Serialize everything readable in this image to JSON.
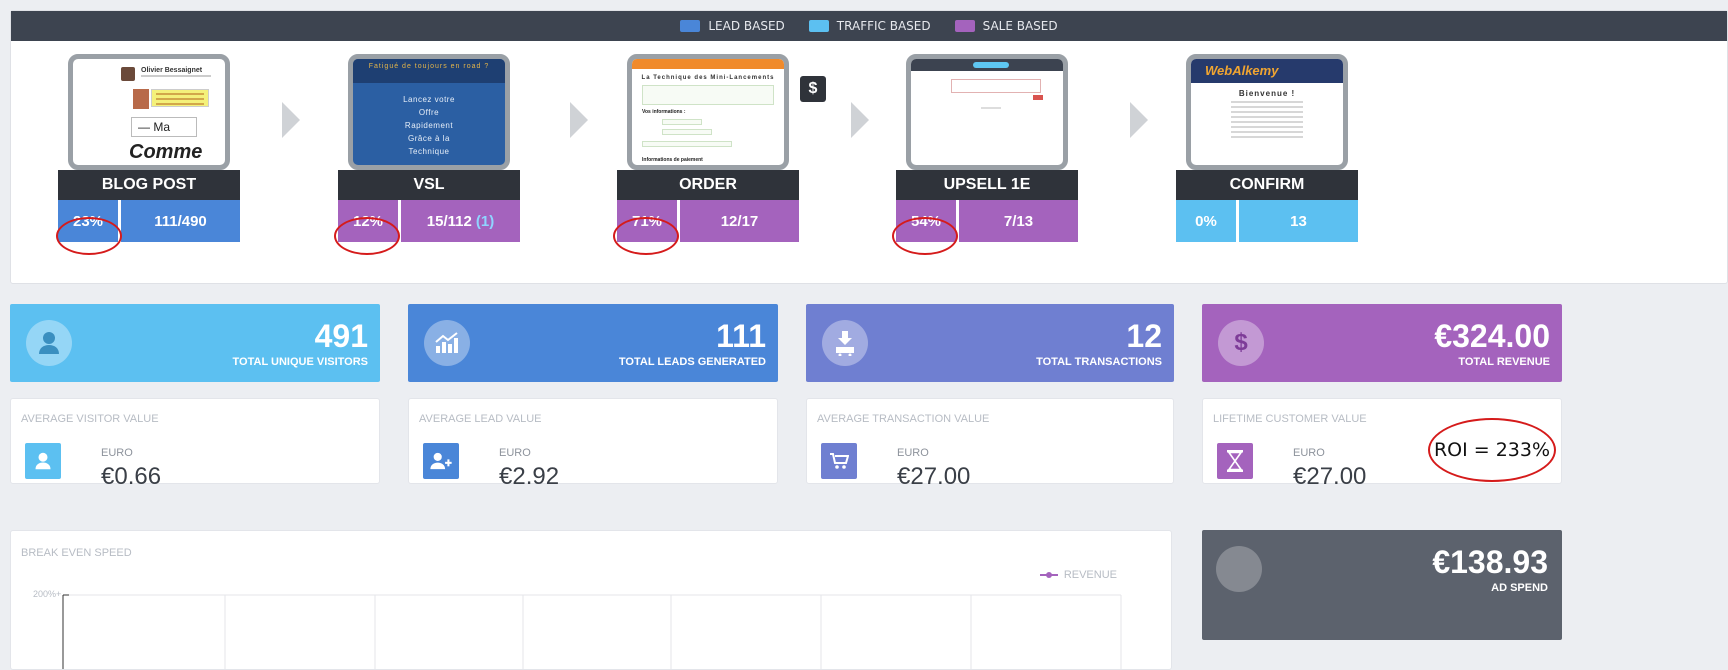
{
  "legend": [
    {
      "label": "LEAD BASED",
      "color": "#4a86d8"
    },
    {
      "label": "TRAFFIC BASED",
      "color": "#5cc0f1"
    },
    {
      "label": "SALE BASED",
      "color": "#a463bd"
    }
  ],
  "colors": {
    "lead": "#4a86d8",
    "traffic": "#5cc0f1",
    "sale": "#a463bd",
    "dark": "#2f333a",
    "annotation": "#d51b1b"
  },
  "funnel": {
    "steps": [
      {
        "title": "BLOG POST",
        "pct": "23%",
        "count": "111/490",
        "paren": "",
        "type": "lead"
      },
      {
        "title": "VSL",
        "pct": "12%",
        "count": "15/112",
        "paren": "(1)",
        "type": "sale"
      },
      {
        "title": "ORDER",
        "pct": "71%",
        "count": "12/17",
        "paren": "",
        "type": "sale"
      },
      {
        "title": "UPSELL 1E",
        "pct": "54%",
        "count": "7/13",
        "paren": "",
        "type": "sale"
      },
      {
        "title": "CONFIRM",
        "pct": "0%",
        "count": "13",
        "paren": "",
        "type": "traffic"
      }
    ],
    "order_badge": "$",
    "thumbs": {
      "blog_name": "Olivier Bessaignet",
      "blog_input": "— Ma",
      "blog_comment": "Comme",
      "vsl_top": "Fatigué de toujours en road ?",
      "vsl_body": [
        "Lancez votre",
        "Offre",
        "Rapidement",
        "Grâce à la",
        "Technique"
      ],
      "order_title": "La Technique des Mini-Lancements",
      "order_label1": "Vos informations :",
      "order_label2": "Informations de paiement",
      "confirm_logo": "WebAlkemy",
      "confirm_heading": "Bienvenue !"
    }
  },
  "stats": [
    {
      "value": "491",
      "label": "TOTAL UNIQUE VISITORS",
      "color": "#5cc0f1",
      "icon": "user-icon"
    },
    {
      "value": "111",
      "label": "TOTAL LEADS GENERATED",
      "color": "#4a86d8",
      "icon": "chart-up-icon"
    },
    {
      "value": "12",
      "label": "TOTAL TRANSACTIONS",
      "color": "#6f7fd1",
      "icon": "cart-download-icon"
    },
    {
      "value": "€324.00",
      "label": "TOTAL REVENUE",
      "color": "#a463bd",
      "icon": "dollar-icon"
    }
  ],
  "values": [
    {
      "title": "AVERAGE VISITOR VALUE",
      "unit": "EURO",
      "value": "€0.66",
      "color": "#5cc0f1",
      "icon": "user-icon"
    },
    {
      "title": "AVERAGE LEAD VALUE",
      "unit": "EURO",
      "value": "€2.92",
      "color": "#4a86d8",
      "icon": "user-add-icon"
    },
    {
      "title": "AVERAGE TRANSACTION VALUE",
      "unit": "EURO",
      "value": "€27.00",
      "color": "#6f7fd1",
      "icon": "cart-icon"
    },
    {
      "title": "LIFETIME CUSTOMER VALUE",
      "unit": "EURO",
      "value": "€27.00",
      "color": "#a463bd",
      "icon": "hourglass-icon"
    }
  ],
  "roi": "ROI = 233%",
  "chart": {
    "title": "BREAK EVEN SPEED",
    "legend": "REVENUE",
    "ytick": "200%+"
  },
  "adspend": {
    "value": "€138.93",
    "label": "AD SPEND"
  }
}
